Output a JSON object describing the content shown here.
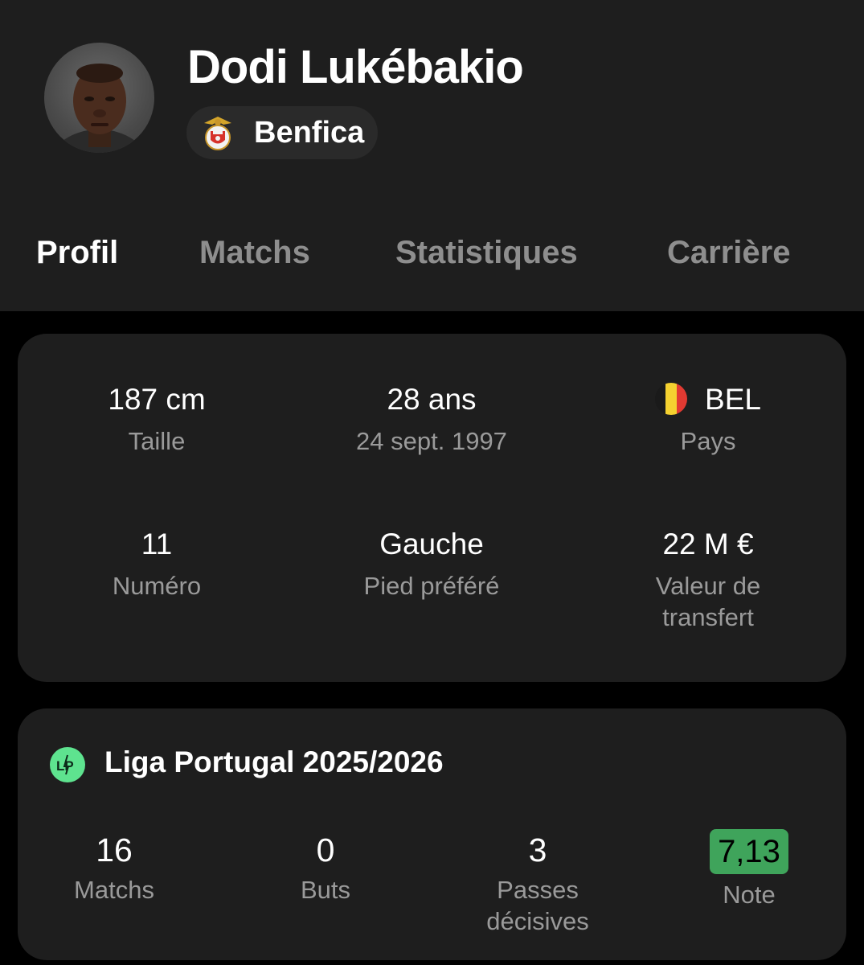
{
  "player": {
    "name": "Dodi Lukébakio",
    "club": "Benfica"
  },
  "tabs": [
    {
      "label": "Profil",
      "active": true
    },
    {
      "label": "Matchs",
      "active": false
    },
    {
      "label": "Statistiques",
      "active": false
    },
    {
      "label": "Carrière",
      "active": false
    }
  ],
  "profile": {
    "height": {
      "value": "187 cm",
      "label": "Taille"
    },
    "age": {
      "value": "28 ans",
      "label": "24 sept. 1997"
    },
    "country": {
      "value": "BEL",
      "label": "Pays",
      "flag_colors": [
        "#1a1a1a",
        "#f5d130",
        "#e23a32"
      ]
    },
    "number": {
      "value": "11",
      "label": "Numéro"
    },
    "foot": {
      "value": "Gauche",
      "label": "Pied préféré"
    },
    "market_value": {
      "value": "22 M €",
      "label_line1": "Valeur de",
      "label_line2": "transfert"
    }
  },
  "league": {
    "title": "Liga Portugal 2025/2026",
    "logo_text": "LP",
    "logo_color": "#5ee38f",
    "stats": {
      "matches": {
        "value": "16",
        "label": "Matchs"
      },
      "goals": {
        "value": "0",
        "label": "Buts"
      },
      "assists": {
        "value": "3",
        "label_line1": "Passes",
        "label_line2": "décisives"
      },
      "rating": {
        "value": "7,13",
        "label": "Note",
        "badge_color": "#3fa45b"
      }
    }
  }
}
